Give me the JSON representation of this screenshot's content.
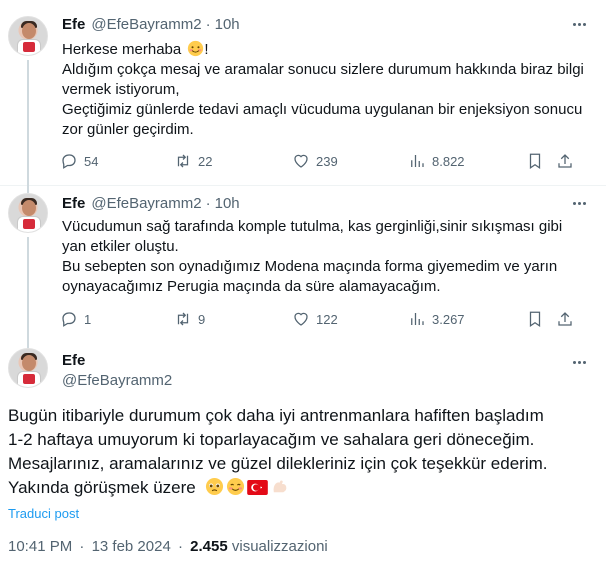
{
  "tweets": [
    {
      "name": "Efe",
      "handle": "@EfeBayramm2",
      "time": "10h",
      "lines": [
        "Herkese merhaba",
        "Aldığım çokça mesaj ve aramalar sonucu sizlere durumum hakkında biraz bilgi vermek istiyorum,",
        "Geçtiğimiz günlerde tedavi amaçlı vücuduma uygulanan bir enjeksiyon sonucu zor günler geçirdim."
      ],
      "line1_suffix": "!",
      "replies": "54",
      "reposts": "22",
      "likes": "239",
      "views": "8.822"
    },
    {
      "name": "Efe",
      "handle": "@EfeBayramm2",
      "time": "10h",
      "lines": [
        "Vücudumun sağ tarafında komple tutulma, kas gerginliği,sinir sıkışması gibi yan etkiler oluştu.",
        "Bu sebepten son oynadığımız Modena maçında forma giyemedim ve yarın oynayacağımız Perugia maçında da süre alamayacağım."
      ],
      "replies": "1",
      "reposts": "9",
      "likes": "122",
      "views": "3.267"
    }
  ],
  "main": {
    "name": "Efe",
    "handle": "@EfeBayramm2",
    "lines": [
      "Bugün itibariyle durumum çok daha iyi antrenmanlara hafiften başladım",
      "1-2 haftaya umuyorum ki toparlayacağım ve sahalara geri döneceğim.",
      "Mesajlarınız, aramalarınız ve güzel dilekleriniz için çok teşekkür ederim.",
      "Yakında görüşmek üzere"
    ],
    "emojis": [
      "pleading-face",
      "smiling-face",
      "turkey-flag",
      "flexed-biceps"
    ],
    "translate": "Traduci post",
    "time": "10:41 PM",
    "sep": "·",
    "date": "13 feb 2024",
    "views_count": "2.455",
    "views_label": "visualizzazioni"
  },
  "sep": "·",
  "colors": {
    "link": "#1d9bf0",
    "muted": "#536471",
    "text": "#0f1419"
  }
}
